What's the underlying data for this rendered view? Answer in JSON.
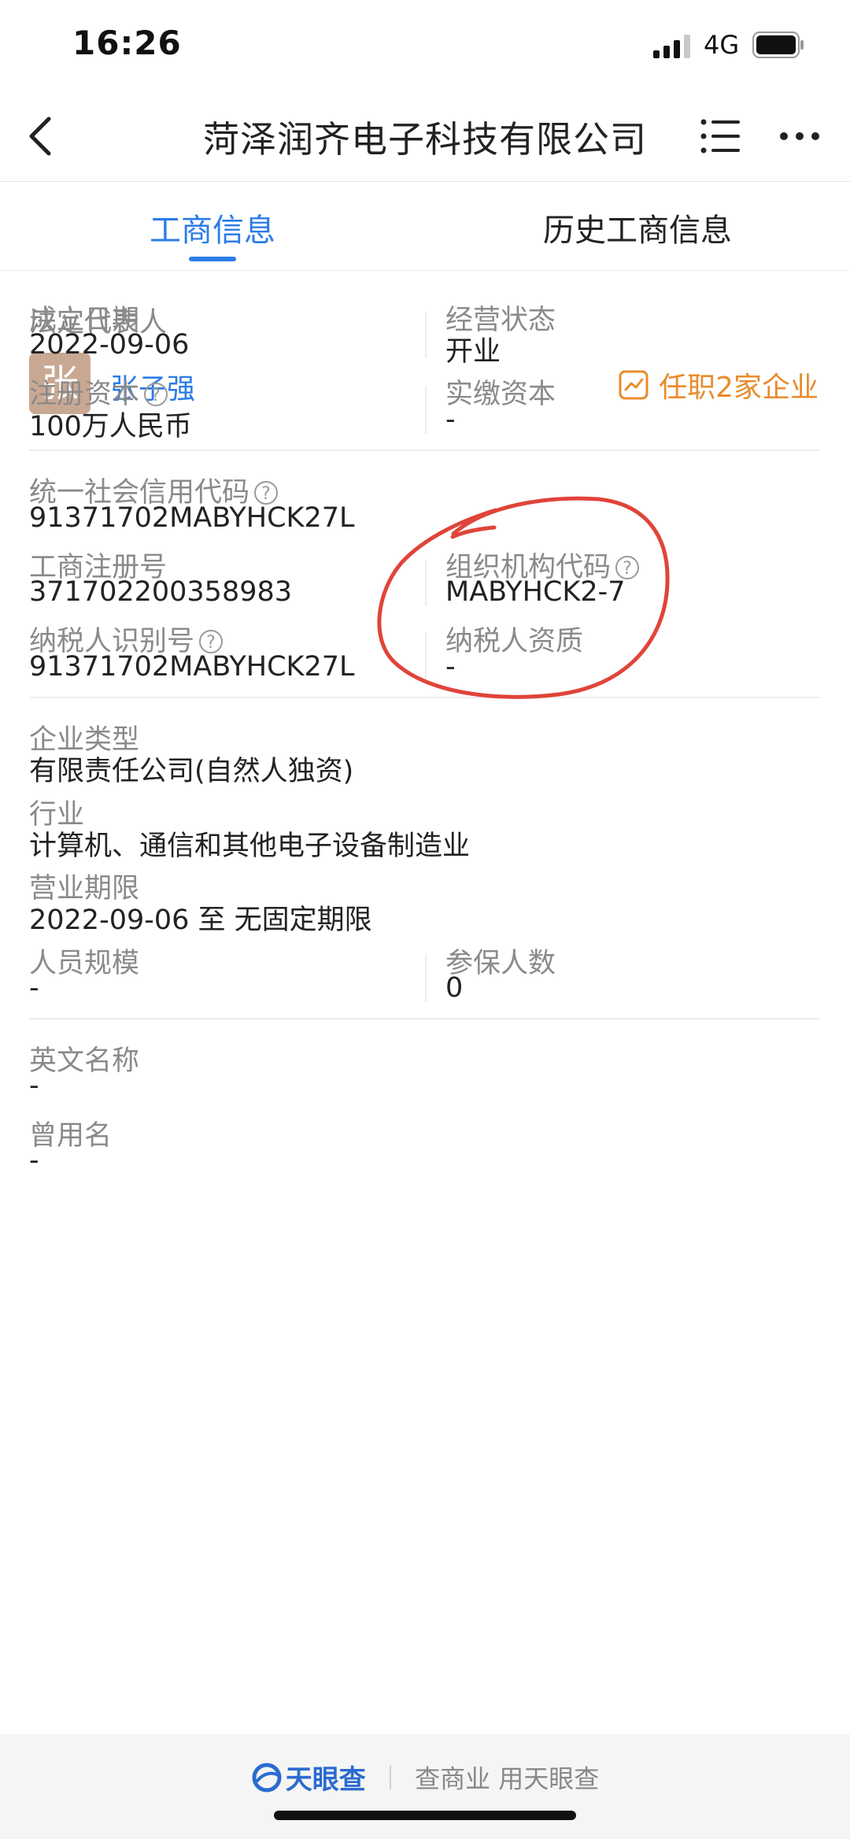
{
  "status": {
    "time": "16:26",
    "network": "4G"
  },
  "nav": {
    "title": "菏泽润齐电子科技有限公司"
  },
  "tabs": [
    {
      "label": "工商信息"
    },
    {
      "label": "历史工商信息"
    }
  ],
  "legal_rep": {
    "label": "法定代表人",
    "avatar_char": "张",
    "name": "张子强",
    "tenure": "任职2家企业"
  },
  "fields": {
    "founded": {
      "label": "成立日期",
      "value": "2022-09-06"
    },
    "status": {
      "label": "经营状态",
      "value": "开业"
    },
    "reg_capital": {
      "label": "注册资本",
      "value": "100万人民币"
    },
    "paid_capital": {
      "label": "实缴资本",
      "value": "-"
    },
    "credit_code": {
      "label": "统一社会信用代码",
      "value": "91371702MABYHCK27L"
    },
    "reg_no": {
      "label": "工商注册号",
      "value": "371702200358983"
    },
    "org_code": {
      "label": "组织机构代码",
      "value": "MABYHCK2-7"
    },
    "taxpayer_id": {
      "label": "纳税人识别号",
      "value": "91371702MABYHCK27L"
    },
    "taxpayer_qual": {
      "label": "纳税人资质",
      "value": "-"
    },
    "company_type": {
      "label": "企业类型",
      "value": "有限责任公司(自然人独资)"
    },
    "industry": {
      "label": "行业",
      "value": "计算机、通信和其他电子设备制造业"
    },
    "term": {
      "label": "营业期限",
      "value": "2022-09-06 至 无固定期限"
    },
    "staff_size": {
      "label": "人员规模",
      "value": "-"
    },
    "insured": {
      "label": "参保人数",
      "value": "0"
    },
    "english_name": {
      "label": "英文名称",
      "value": "-"
    },
    "former_name": {
      "label": "曾用名",
      "value": "-"
    }
  },
  "help_glyph": "?",
  "footer": {
    "brand": "天眼查",
    "slogan": "查商业 用天眼查"
  },
  "colors": {
    "accent": "#2b7ce6",
    "orange": "#e88c2c",
    "annotation": "#e0443a"
  }
}
